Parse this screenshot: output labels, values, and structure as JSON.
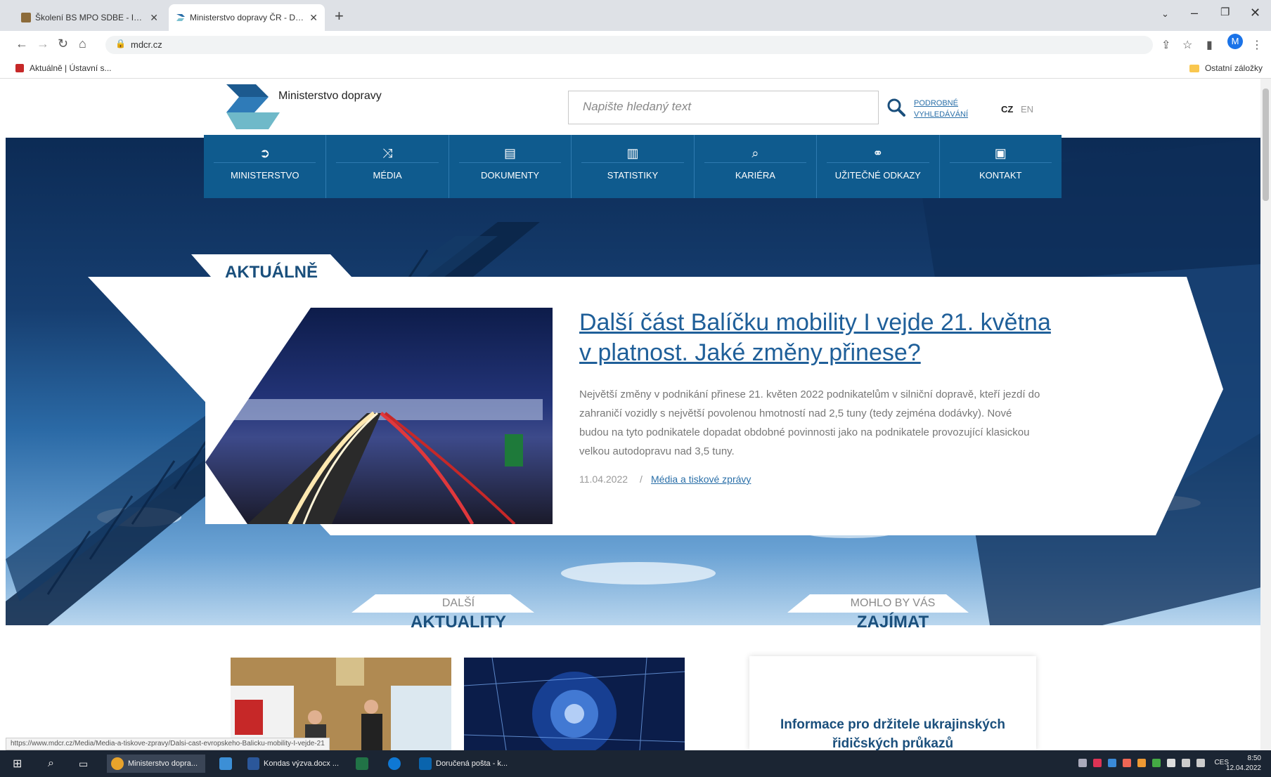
{
  "browser": {
    "tabs": [
      {
        "title": "Školení BS MPO SDBE - Intranet",
        "active": false
      },
      {
        "title": "Ministerstvo dopravy ČR - Domů",
        "active": true
      }
    ],
    "url": "mdcr.cz",
    "bookmarks": [
      {
        "label": "Aktuálně | Ústavní s..."
      }
    ],
    "other_bookmarks": "Ostatní záložky",
    "profile_initial": "M",
    "status_url": "https://www.mdcr.cz/Media/Media-a-tiskove-zpravy/Dalsi-cast-evropskeho-Balicku-mobility-I-vejde-21"
  },
  "header": {
    "logo_text": "Ministerstvo dopravy",
    "search_placeholder": "Napište hledaný text",
    "advanced_search": "PODROBNÉ VYHLEDÁVÁNÍ",
    "lang_cz": "CZ",
    "lang_en": "EN"
  },
  "nav": [
    {
      "label": "MINISTERSTVO",
      "icon": "arrow-logo-icon"
    },
    {
      "label": "MÉDIA",
      "icon": "shuffle-icon"
    },
    {
      "label": "DOKUMENTY",
      "icon": "document-icon"
    },
    {
      "label": "STATISTIKY",
      "icon": "bar-chart-icon"
    },
    {
      "label": "KARIÉRA",
      "icon": "magnifier-icon"
    },
    {
      "label": "UŽITEČNÉ ODKAZY",
      "icon": "link-icon"
    },
    {
      "label": "KONTAKT",
      "icon": "contact-card-icon"
    }
  ],
  "news": {
    "section_label": "AKTUÁLNĚ",
    "title": "Další část Balíčku mobility I vejde 21. května v platnost. Jaké změny přinese?",
    "text": "Největší změny v podnikání přinese 21. květen 2022 podnikatelům v silniční dopravě, kteří jezdí do zahraničí vozidly s největší povolenou hmotností nad 2,5 tuny (tedy zejména dodávky). Nové budou na tyto podnikatele dopadat obdobné povinnosti jako na podnikatele provozující klasickou velkou autodopravu nad 3,5 tuny.",
    "date": "11.04.2022",
    "separator": "/",
    "category": "Média a tiskové zprávy"
  },
  "sections": {
    "more_news_small": "DALŠÍ",
    "more_news_big": "AKTUALITY",
    "interest_small": "MOHLO BY VÁS",
    "interest_big": "ZAJÍMAT"
  },
  "info_card": {
    "text": "Informace pro držitele ukrajinských řidičských průkazů"
  },
  "taskbar": {
    "items": [
      {
        "label": "Ministerstvo dopra...",
        "color": "#e8a32b"
      },
      {
        "label": "",
        "color": "#3c8fd6"
      },
      {
        "label": "Kondas výzva.docx ...",
        "color": "#2b579a"
      },
      {
        "label": "",
        "color": "#217346"
      },
      {
        "label": "",
        "color": "#0f78d4"
      },
      {
        "label": "Doručená pošta - k...",
        "color": "#0a64ad"
      }
    ],
    "lang": "CES",
    "time": "8:50",
    "date": "12.04.2022"
  }
}
